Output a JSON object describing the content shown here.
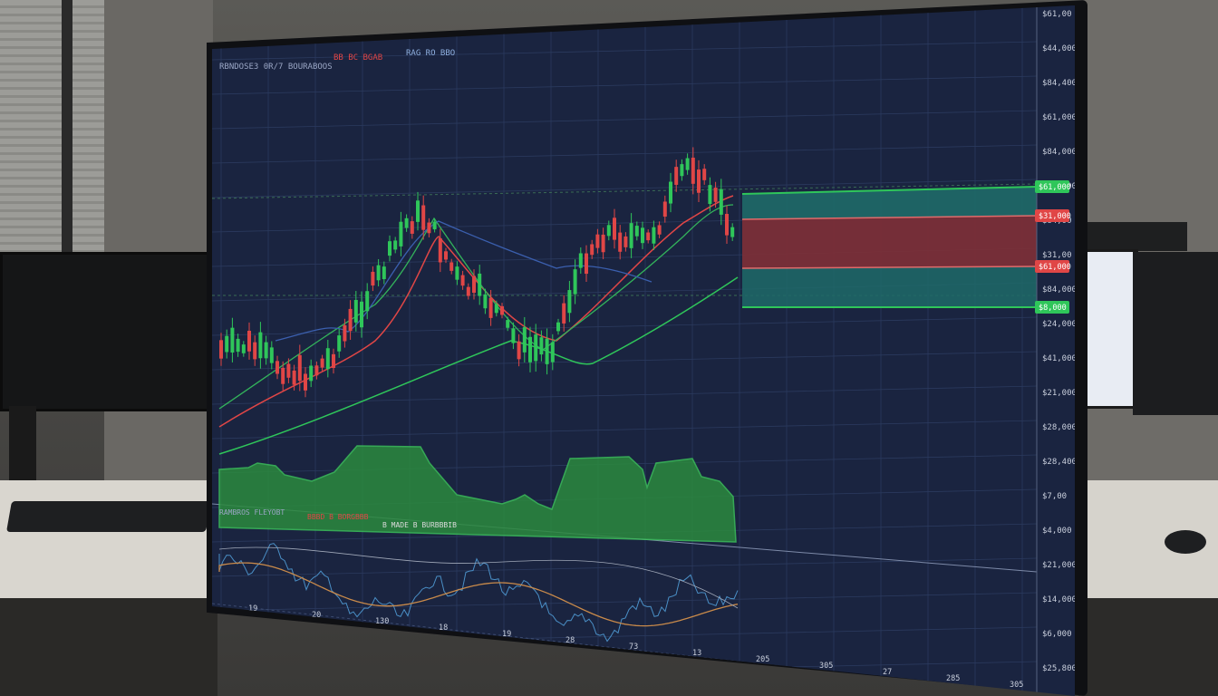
{
  "header": {
    "symbol": "RBNDOSE3 0R/7 BOURABOOS",
    "change": "BB BC BGAB",
    "interval": "RAG RO BBO"
  },
  "indicator_header": {
    "text1": "RAMBROS FLEYOBT",
    "text2": "BBBD B BORGBBB",
    "text3": "B MADE B BURBBBIB"
  },
  "price_axis": [
    "$61,00",
    "$44,000",
    "$84,400",
    "$61,000",
    "$84,000",
    "$81,000",
    "$84,00",
    "$31,00",
    "$84,000",
    "$24,000",
    "$41,000",
    "$21,000",
    "$28,000",
    "$28,400",
    "$7,00",
    "$4,000",
    "$21,000",
    "$14,000",
    "$6,000",
    "$25,800"
  ],
  "price_tags": [
    {
      "label": "$61,000",
      "color": "#2fc65a"
    },
    {
      "label": "$31,000",
      "color": "#e04646"
    },
    {
      "label": "$61,000",
      "color": "#e04646"
    },
    {
      "label": "$8,000",
      "color": "#2fc65a"
    }
  ],
  "time_axis": [
    "19",
    "20",
    "130",
    "18",
    "19",
    "28",
    "73",
    "13",
    "205",
    "305",
    "27",
    "285",
    "305"
  ],
  "colors": {
    "background": "#1a2440",
    "bull": "#2fc65a",
    "bear": "#e04646",
    "ma_fast": "#e04646",
    "ma_slow": "#2fc65a",
    "ma_blue": "#3b5fae",
    "volume": "#2b8a3e"
  }
}
